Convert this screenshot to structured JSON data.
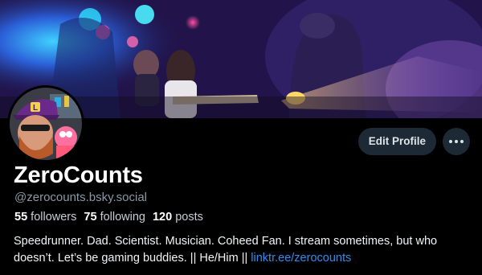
{
  "profile": {
    "display_name": "ZeroCounts",
    "handle": "@zerocounts.bsky.social",
    "stats": {
      "followers_count": "55",
      "followers_label": "followers",
      "following_count": "75",
      "following_label": "following",
      "posts_count": "120",
      "posts_label": "posts"
    },
    "bio": {
      "text": "Speedrunner. Dad. Scientist. Musician. Coheed Fan. I stream sometimes, but who doesn’t. Let’s be gaming buddies. || He/Him ||",
      "link_text": "linktr.ee/zerocounts"
    }
  },
  "actions": {
    "edit_profile_label": "Edit Profile",
    "more_icon": "ellipsis-icon"
  },
  "colors": {
    "background": "#000000",
    "button_bg": "#1e2936",
    "link": "#2b8ef6",
    "muted_text": "#8b98a5"
  }
}
